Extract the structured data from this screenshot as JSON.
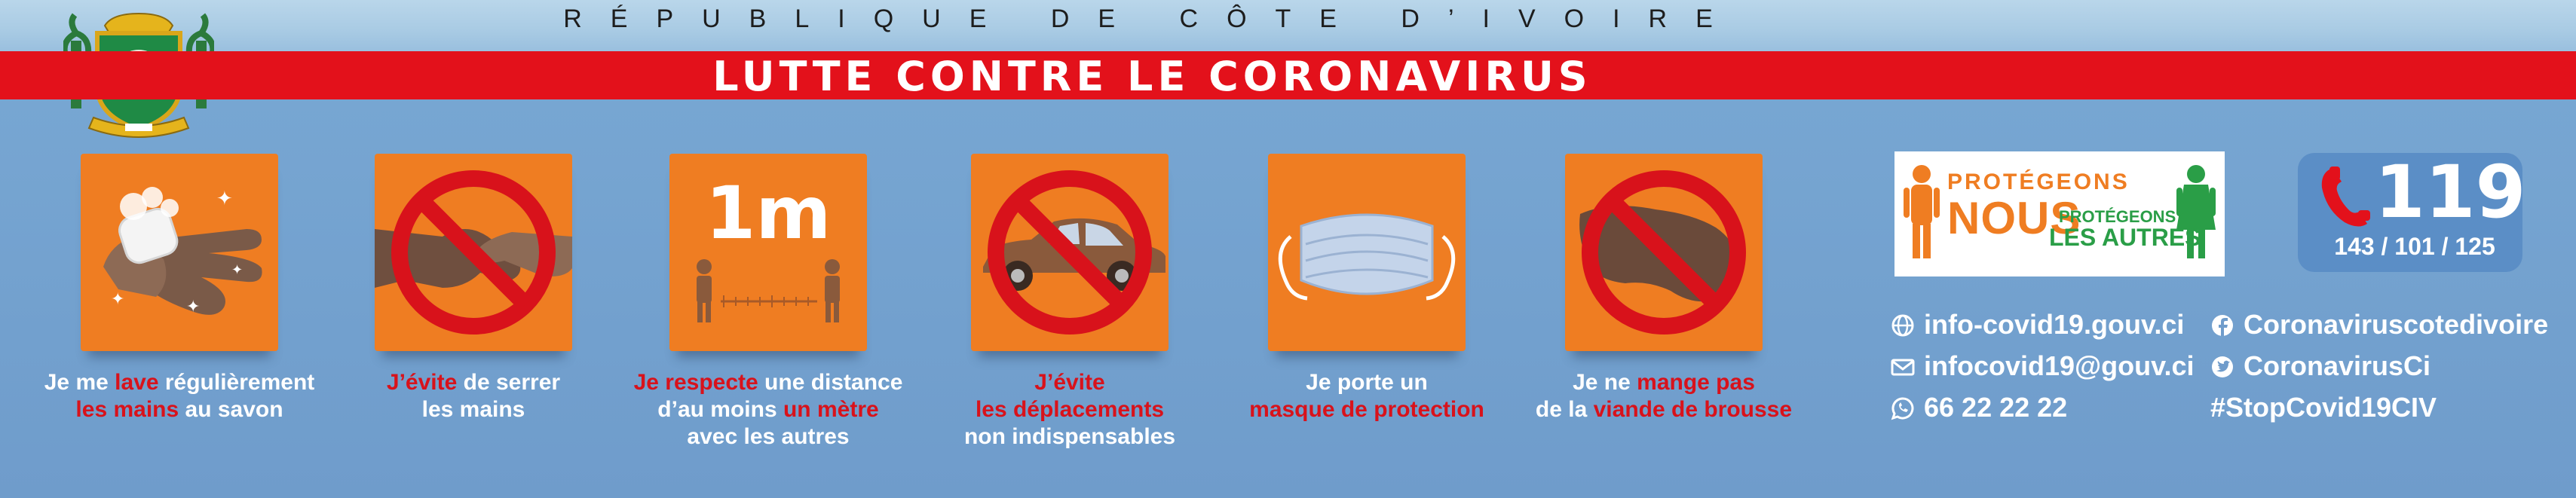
{
  "header": {
    "top_title": "RÉPUBLIQUE DE CÔTE D’IVOIRE",
    "red_title": "LUTTE CONTRE LE CORONAVIRUS",
    "red_band_color": "#e3111b"
  },
  "coat_of_arms": {
    "icon": "coat-of-arms-icon"
  },
  "tiles": [
    {
      "icon": "hand-washing-icon",
      "caption": [
        [
          {
            "t": "Je me ",
            "r": false
          },
          {
            "t": "lave",
            "r": true
          },
          {
            "t": " régulièrement",
            "r": false
          }
        ],
        [
          {
            "t": "les mains",
            "r": true
          },
          {
            "t": " au savon",
            "r": false
          }
        ]
      ]
    },
    {
      "icon": "no-handshake-icon",
      "caption": [
        [
          {
            "t": "J’évite",
            "r": true
          },
          {
            "t": " de serrer",
            "r": false
          }
        ],
        [
          {
            "t": "les mains",
            "r": false
          }
        ]
      ]
    },
    {
      "icon": "distance-1m-icon",
      "big_label": "1m",
      "caption": [
        [
          {
            "t": "Je respecte",
            "r": true
          },
          {
            "t": " une distance",
            "r": false
          }
        ],
        [
          {
            "t": "d’au moins ",
            "r": false
          },
          {
            "t": "un mètre",
            "r": true
          }
        ],
        [
          {
            "t": "avec les autres",
            "r": false
          }
        ]
      ]
    },
    {
      "icon": "no-car-icon",
      "caption": [
        [
          {
            "t": "J’évite",
            "r": true
          }
        ],
        [
          {
            "t": "les déplacements",
            "r": true
          }
        ],
        [
          {
            "t": "non indispensables",
            "r": false
          }
        ]
      ]
    },
    {
      "icon": "face-mask-icon",
      "caption": [
        [
          {
            "t": "Je porte un",
            "r": false
          }
        ],
        [
          {
            "t": "masque de protection",
            "r": true
          }
        ]
      ]
    },
    {
      "icon": "no-bushmeat-icon",
      "caption": [
        [
          {
            "t": "Je ne ",
            "r": false
          },
          {
            "t": "mange pas",
            "r": true
          }
        ],
        [
          {
            "t": "de la ",
            "r": false
          },
          {
            "t": "viande de brousse",
            "r": true
          }
        ]
      ]
    }
  ],
  "slogan": {
    "line1": "PROTÉGEONS",
    "line2": "NOUS",
    "line3": "PROTÉGEONS",
    "line4": "LES AUTRES",
    "orange": "#ef7d22",
    "green": "#2a9e47"
  },
  "emergency": {
    "icon": "phone-icon",
    "number": "119",
    "other_numbers": "143 / 101 / 125"
  },
  "contacts": {
    "website": {
      "icon": "globe-icon",
      "text": "info-covid19.gouv.ci"
    },
    "email": {
      "icon": "mail-icon",
      "text": "infocovid19@gouv.ci"
    },
    "whatsapp": {
      "icon": "whatsapp-icon",
      "text": "66 22 22 22"
    },
    "facebook": {
      "icon": "facebook-icon",
      "text": "Coronaviruscotedivoire"
    },
    "twitter": {
      "icon": "twitter-icon",
      "text": "CoronavirusCi"
    },
    "hashtag": "#StopCovid19CIV"
  },
  "colors": {
    "tile_orange": "#ef7d22",
    "text_red": "#d8121b",
    "background_blue": "#6f9ccb"
  }
}
